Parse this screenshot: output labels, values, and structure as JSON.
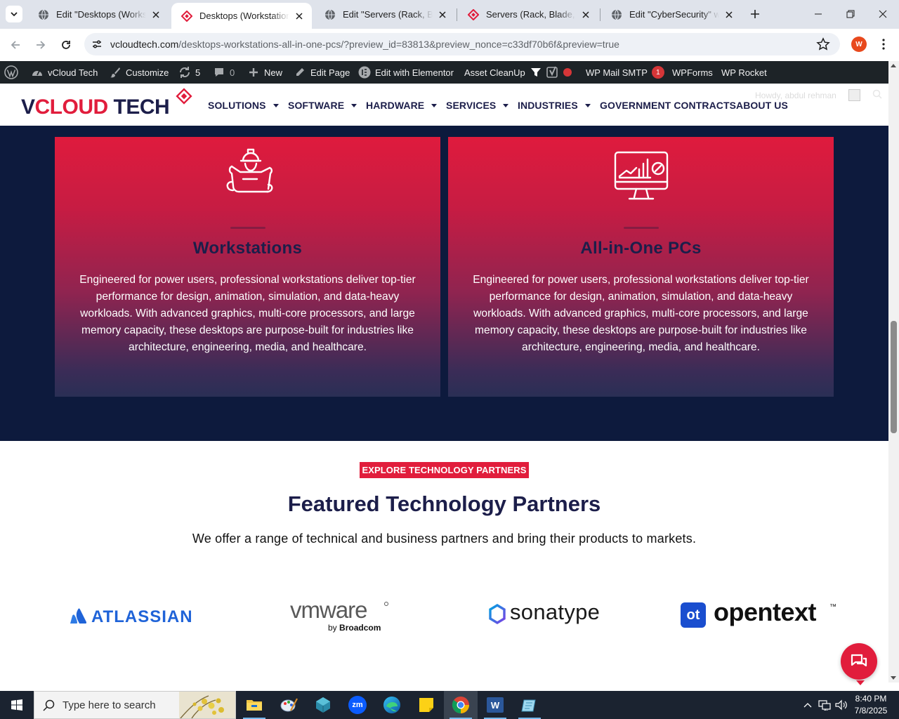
{
  "browser": {
    "tabs": [
      {
        "title": "Edit \"Desktops (Workstations, All-in-One PCs)\"",
        "active": false,
        "favicon": "globe-icon"
      },
      {
        "title": "Desktops (Workstations, All-in-One PCs)",
        "active": true,
        "favicon": "vcloud-favicon"
      },
      {
        "title": "Edit \"Servers (Rack, Blade, Tower)\"",
        "active": false,
        "favicon": "globe-icon"
      },
      {
        "title": "Servers (Rack, Blade, Tower)",
        "active": false,
        "favicon": "vcloud-favicon"
      },
      {
        "title": "Edit \"CyberSecurity\" with Elementor",
        "active": false,
        "favicon": "globe-icon"
      }
    ],
    "url_host": "vcloudtech.com",
    "url_rest": "/desktops-workstations-all-in-one-pcs/?preview_id=83813&preview_nonce=c33df70b6f&preview=true",
    "profile_initial": "W"
  },
  "adminbar": {
    "site_name": "vCloud Tech",
    "customize": "Customize",
    "updates_count": "5",
    "comments_count": "0",
    "new": "New",
    "edit_page": "Edit Page",
    "edit_elementor": "Edit with Elementor",
    "asset_cleanup": "Asset CleanUp",
    "wp_mail_smtp": "WP Mail SMTP",
    "wp_mail_smtp_badge": "1",
    "wpforms": "WPForms",
    "wp_rocket": "WP Rocket"
  },
  "header": {
    "logo_text": "VCLOUD TECH",
    "nav": [
      {
        "label": "SOLUTIONS",
        "has_caret": true
      },
      {
        "label": "SOFTWARE",
        "has_caret": true
      },
      {
        "label": "HARDWARE",
        "has_caret": true
      },
      {
        "label": "SERVICES",
        "has_caret": true
      },
      {
        "label": "INDUSTRIES",
        "has_caret": true
      },
      {
        "label": "GOVERNMENT CONTRACTS",
        "has_caret": false
      },
      {
        "label": "ABOUT US",
        "has_caret": false
      }
    ],
    "howdy": "Howdy, abdul rehman"
  },
  "cards": [
    {
      "icon": "engineer-blueprint-icon",
      "title": "Workstations",
      "body": "Engineered for power users, professional workstations deliver top-tier performance for design, animation, simulation, and data-heavy workloads. With advanced graphics, multi-core processors, and large memory capacity, these desktops are purpose-built for industries like architecture, engineering, media, and healthcare."
    },
    {
      "icon": "monitor-analytics-icon",
      "title": "All-in-One PCs",
      "body": "Engineered for power users, professional workstations deliver top-tier performance for design, animation, simulation, and data-heavy workloads. With advanced graphics, multi-core processors, and large memory capacity, these desktops are purpose-built for industries like architecture, engineering, media, and healthcare."
    }
  ],
  "partners": {
    "eyebrow": "EXPLORE TECHNOLOGY PARTNERS",
    "title": "Featured Technology Partners",
    "subtitle": "We offer a range of technical and business partners and bring their products to markets.",
    "logos": [
      {
        "name": "ATLASSIAN"
      },
      {
        "name": "vmware",
        "tagline_prefix": "by",
        "tagline_brand": "Broadcom"
      },
      {
        "name": "sonatype"
      },
      {
        "name": "opentext",
        "mark": "ot",
        "tm": "™"
      }
    ]
  },
  "taskbar": {
    "search_placeholder": "Type here to search",
    "apps": [
      "file-explorer-icon",
      "paint-icon",
      "app-icon",
      "zoom-icon",
      "edge-icon",
      "sticky-notes-icon",
      "chrome-icon",
      "word-icon",
      "notepad-icon"
    ],
    "zoom_label": "zm",
    "word_label": "W",
    "time": "8:40 PM",
    "date": "7/8/2025"
  },
  "colors": {
    "navy": "#0d1a3d",
    "brand_red": "#e11d3c",
    "title_navy": "#1c1e4a"
  }
}
